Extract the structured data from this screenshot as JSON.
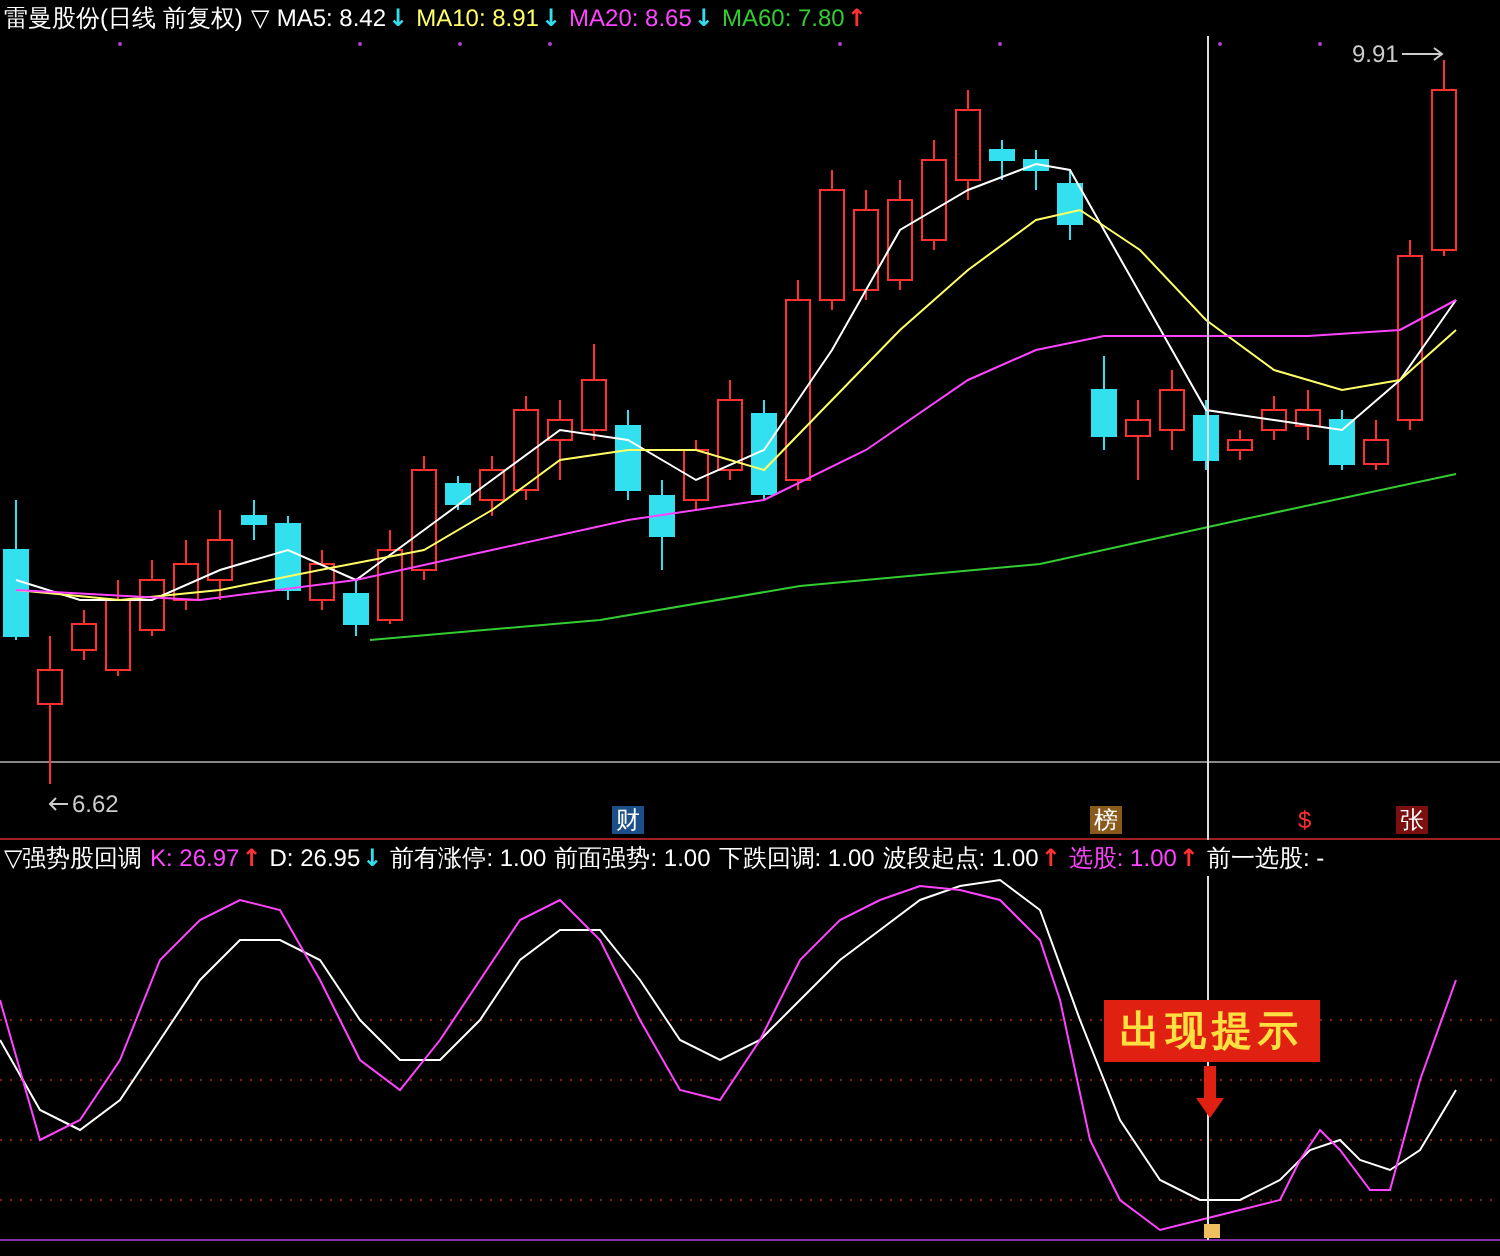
{
  "main_chart": {
    "title": "雷曼股份(日线 前复权)",
    "toggle": "▽",
    "ma": [
      {
        "label": "MA5: 8.42",
        "color": "#ffffff",
        "arrow": {
          "text": "↓",
          "color": "#33ddee"
        }
      },
      {
        "label": "MA10: 8.91",
        "color": "#ffff66",
        "arrow": {
          "text": "↓",
          "color": "#33ddee"
        }
      },
      {
        "label": "MA20: 8.65",
        "color": "#ff44ff",
        "arrow": {
          "text": "↓",
          "color": "#33ddee"
        }
      },
      {
        "label": "MA60: 7.80",
        "color": "#33cc33",
        "arrow": {
          "text": "↑",
          "color": "#ff3030"
        }
      }
    ],
    "high_label": "9.91",
    "low_label": "6.62",
    "events": [
      {
        "label": "财",
        "color": "#1c4f8a"
      },
      {
        "label": "榜",
        "color": "#8a5a1c"
      },
      {
        "label": "$",
        "color": "#000000"
      },
      {
        "label": "张",
        "color": "#7a1010"
      }
    ]
  },
  "indicator": {
    "toggle": "▽",
    "title": "强势股回调",
    "values": [
      {
        "label": "K: 26.97",
        "color": "#ff44ff",
        "arrow": {
          "text": "↑",
          "color": "#ff3030"
        }
      },
      {
        "label": "D: 26.95",
        "color": "#ffffff",
        "arrow": {
          "text": "↓",
          "color": "#33ddee"
        }
      },
      {
        "label": "前有涨停: 1.00",
        "color": "#ffffff"
      },
      {
        "label": "前面强势: 1.00",
        "color": "#ffffff"
      },
      {
        "label": "下跌回调: 1.00",
        "color": "#ffffff"
      },
      {
        "label": "波段起点: 1.00",
        "color": "#ffffff",
        "arrow": {
          "text": "↑",
          "color": "#ff3030"
        }
      },
      {
        "label": "选股: 1.00",
        "color": "#ff44ff",
        "arrow": {
          "text": "↑",
          "color": "#ff3030"
        }
      },
      {
        "label": "前一选股: -",
        "color": "#ffffff"
      }
    ],
    "callout": "出现提示"
  }
}
